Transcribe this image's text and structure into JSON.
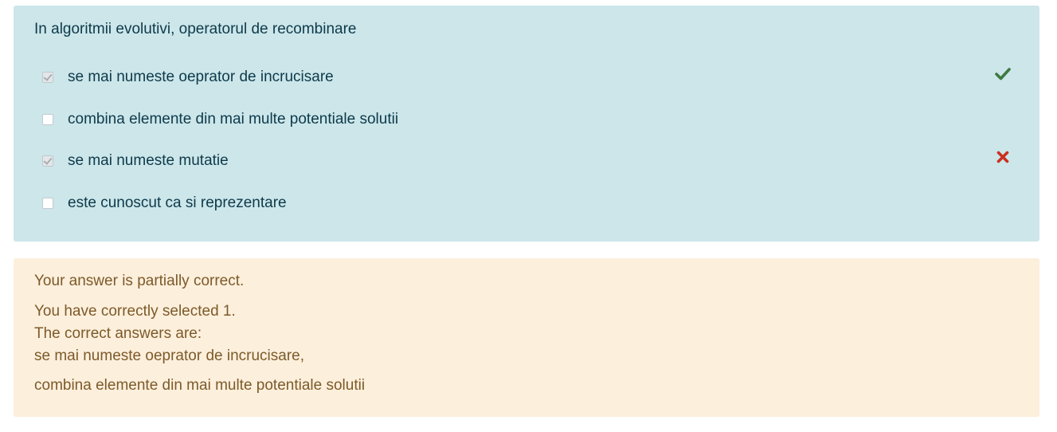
{
  "question": {
    "prompt": "In algoritmii evolutivi, operatorul de recombinare",
    "options": [
      {
        "label": "se mai numeste oeprator de incrucisare",
        "checked": true,
        "status": "correct",
        "status_icon": "check-icon",
        "status_color": "#3d7a3f"
      },
      {
        "label": "combina elemente din mai multe potentiale solutii",
        "checked": false,
        "status": "",
        "status_icon": "",
        "status_color": ""
      },
      {
        "label": "se mai numeste mutatie",
        "checked": true,
        "status": "incorrect",
        "status_icon": "cross-icon",
        "status_color": "#ca3120"
      },
      {
        "label": "este cunoscut ca si reprezentare",
        "checked": false,
        "status": "",
        "status_icon": "",
        "status_color": ""
      }
    ],
    "background_color": "#cce6ea"
  },
  "feedback": {
    "summary": "Your answer is partially correct.",
    "selected_count": "You have correctly selected 1.",
    "correct_heading": "The correct answers are:",
    "correct_answers": [
      "se mai numeste oeprator de incrucisare,",
      "combina elemente din mai multe potentiale solutii"
    ],
    "background_color": "#fcefdc"
  }
}
